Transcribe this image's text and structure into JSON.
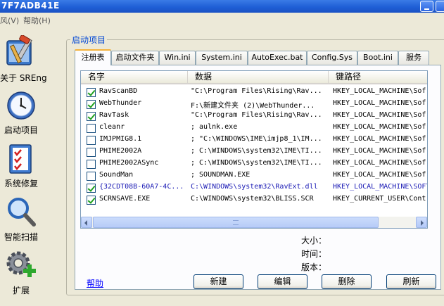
{
  "window": {
    "title": "7F7ADB41E"
  },
  "menu": {
    "items": [
      "风(V)",
      "帮助(H)"
    ]
  },
  "nav": {
    "items": [
      {
        "label": "关于 SREng",
        "icon": "tools-icon"
      },
      {
        "label": "启动项目",
        "icon": "clock-icon"
      },
      {
        "label": "系统修复",
        "icon": "checklist-icon"
      },
      {
        "label": "智能扫描",
        "icon": "magnifier-icon"
      },
      {
        "label": "扩展",
        "icon": "gear-plus-icon"
      }
    ]
  },
  "group": {
    "title": "启动项目"
  },
  "tabs": [
    "注册表",
    "启动文件夹",
    "Win.ini",
    "System.ini",
    "AutoExec.bat",
    "Config.Sys",
    "Boot.ini",
    "服务"
  ],
  "list": {
    "columns": [
      "名字",
      "数据",
      "键路径"
    ],
    "rows": [
      {
        "checked": true,
        "name": "RavScanBD",
        "data": "\"C:\\Program Files\\Rising\\Rav...",
        "key": "HKEY_LOCAL_MACHINE\\Sof"
      },
      {
        "checked": true,
        "name": "WebThunder",
        "data": "F:\\新建文件夹 (2)\\WebThunder...",
        "key": "HKEY_LOCAL_MACHINE\\Sof"
      },
      {
        "checked": true,
        "name": "RavTask",
        "data": "\"C:\\Program Files\\Rising\\Rav...",
        "key": "HKEY_LOCAL_MACHINE\\Sof"
      },
      {
        "checked": false,
        "name": "cleanr",
        "data": "; aulnk.exe",
        "key": "HKEY_LOCAL_MACHINE\\Sof"
      },
      {
        "checked": false,
        "name": "IMJPMIG8.1",
        "data": "; \"C:\\WINDOWS\\IME\\imjp8_1\\IM...",
        "key": "HKEY_LOCAL_MACHINE\\Sof"
      },
      {
        "checked": false,
        "name": "PHIME2002A",
        "data": "; C:\\WINDOWS\\system32\\IME\\TI...",
        "key": "HKEY_LOCAL_MACHINE\\Sof"
      },
      {
        "checked": false,
        "name": "PHIME2002ASync",
        "data": "; C:\\WINDOWS\\system32\\IME\\TI...",
        "key": "HKEY_LOCAL_MACHINE\\Sof"
      },
      {
        "checked": false,
        "name": "SoundMan",
        "data": "; SOUNDMAN.EXE",
        "key": "HKEY_LOCAL_MACHINE\\Sof"
      },
      {
        "checked": true,
        "name": "{32CDT08B-60A7-4C...",
        "data": "C:\\WINDOWS\\system32\\RavExt.dll",
        "key": "HKEY_LOCAL_MACHINE\\SOFT",
        "blue": true
      },
      {
        "checked": true,
        "name": "SCRNSAVE.EXE",
        "data": "C:\\WINDOWS\\system32\\BLISS.SCR",
        "key": "HKEY_CURRENT_USER\\Cont"
      }
    ]
  },
  "info": {
    "size_label": "大小：",
    "time_label": "时间：",
    "version_label": "版本："
  },
  "help": {
    "label": "帮助"
  },
  "buttons": {
    "new": "新建",
    "edit": "编辑",
    "delete": "删除",
    "refresh": "刷新"
  }
}
